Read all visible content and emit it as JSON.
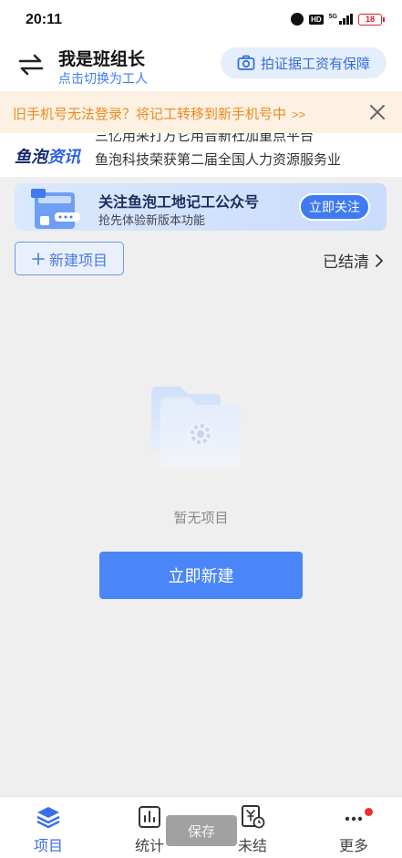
{
  "status_bar": {
    "time": "20:11",
    "hd": "HD",
    "network": "5G",
    "battery": "18"
  },
  "header": {
    "title": "我是班组长",
    "subtitle": "点击切换为工人",
    "guarantee_button": "拍证据工资有保障"
  },
  "notice": {
    "text": "旧手机号无法登录？将记工转移到新手机号中",
    "arrow": ">>"
  },
  "news": {
    "logo_part1": "鱼泡",
    "logo_part2": "资讯",
    "line1": "三亿用采打方它用音新社加重点平台",
    "line2": "鱼泡科技荣获第二届全国人力资源服务业"
  },
  "follow_banner": {
    "title": "关注鱼泡工地记工公众号",
    "subtitle": "抢先体验新版本功能",
    "button": "立即关注"
  },
  "toolbar": {
    "new_project": "新建项目",
    "settled": "已结清"
  },
  "empty_state": {
    "text": "暂无项目",
    "button": "立即新建"
  },
  "tabs": [
    {
      "label": "项目",
      "icon": "layers-icon",
      "active": true
    },
    {
      "label": "统计",
      "icon": "bar-chart-icon",
      "active": false
    },
    {
      "label": "未结",
      "icon": "yuan-clock-icon",
      "active": false
    },
    {
      "label": "更多",
      "icon": "more-dots-icon",
      "active": false
    }
  ],
  "toast": {
    "text": "保存"
  },
  "colors": {
    "primary": "#4a86f7",
    "notice": "#ee8a1b",
    "badge": "#ee2d2d"
  }
}
